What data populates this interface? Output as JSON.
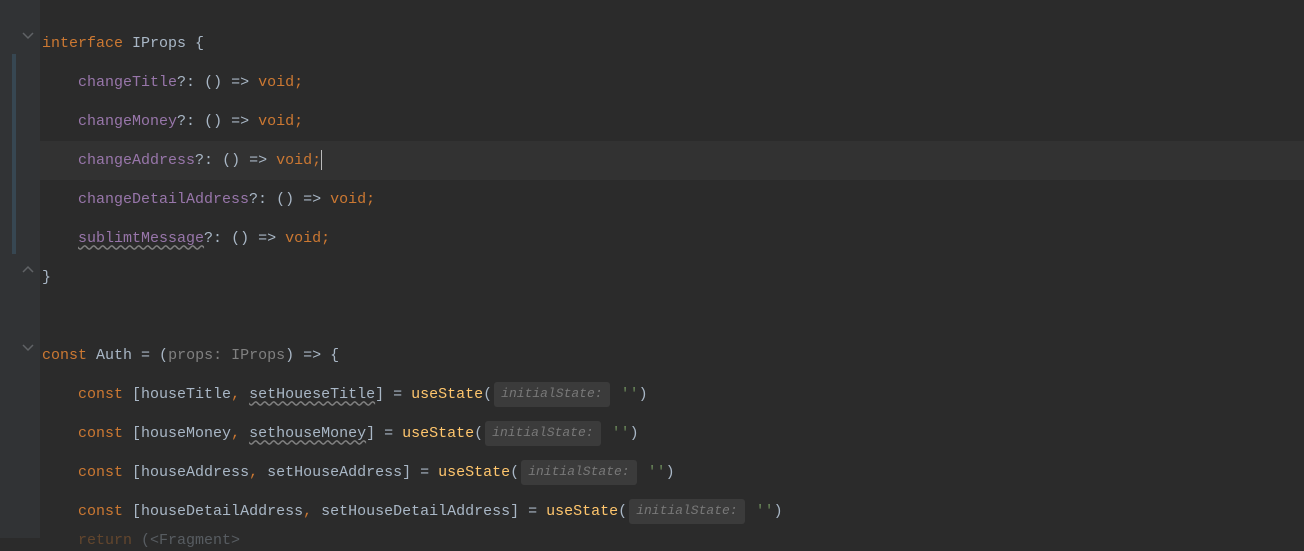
{
  "code": {
    "kw_interface": "interface",
    "iface_name": "IProps",
    "brace_open": " {",
    "indent1": "    ",
    "prop1": "changeTitle",
    "prop2": "changeMoney",
    "prop3": "changeAddress",
    "prop4": "changeDetailAddress",
    "prop5": "sublimtMessage",
    "opt_colon": "?: ",
    "fn_sig_open": "() ",
    "arrow": "=> ",
    "void": "void",
    "semi": ";",
    "brace_close": "}",
    "kw_const": "const",
    "auth_name": " Auth ",
    "eq": "= ",
    "params_open": "(",
    "param_props": "props",
    "colon_type": ": IProps",
    "params_close": ") ",
    "body_open": "{",
    "destruct_open": " [",
    "comma_sp": ", ",
    "destruct_close": "] ",
    "useState": "useState",
    "call_open": "(",
    "hint_initialState": "initialState:",
    "empty_str_open": " '",
    "empty_str_close": "'",
    "call_close": ")",
    "var1a": "houseTitle",
    "var1b": "setHoueseTitle",
    "var2a": "houseMoney",
    "var2b": "sethouseMoney",
    "var3a": "houseAddress",
    "var3b": "setHouseAddress",
    "var4a": "houseDetailAddress",
    "var4b": "setHouseDetailAddress",
    "kw_return": "return",
    "return_rest": " (<Fragment>"
  }
}
